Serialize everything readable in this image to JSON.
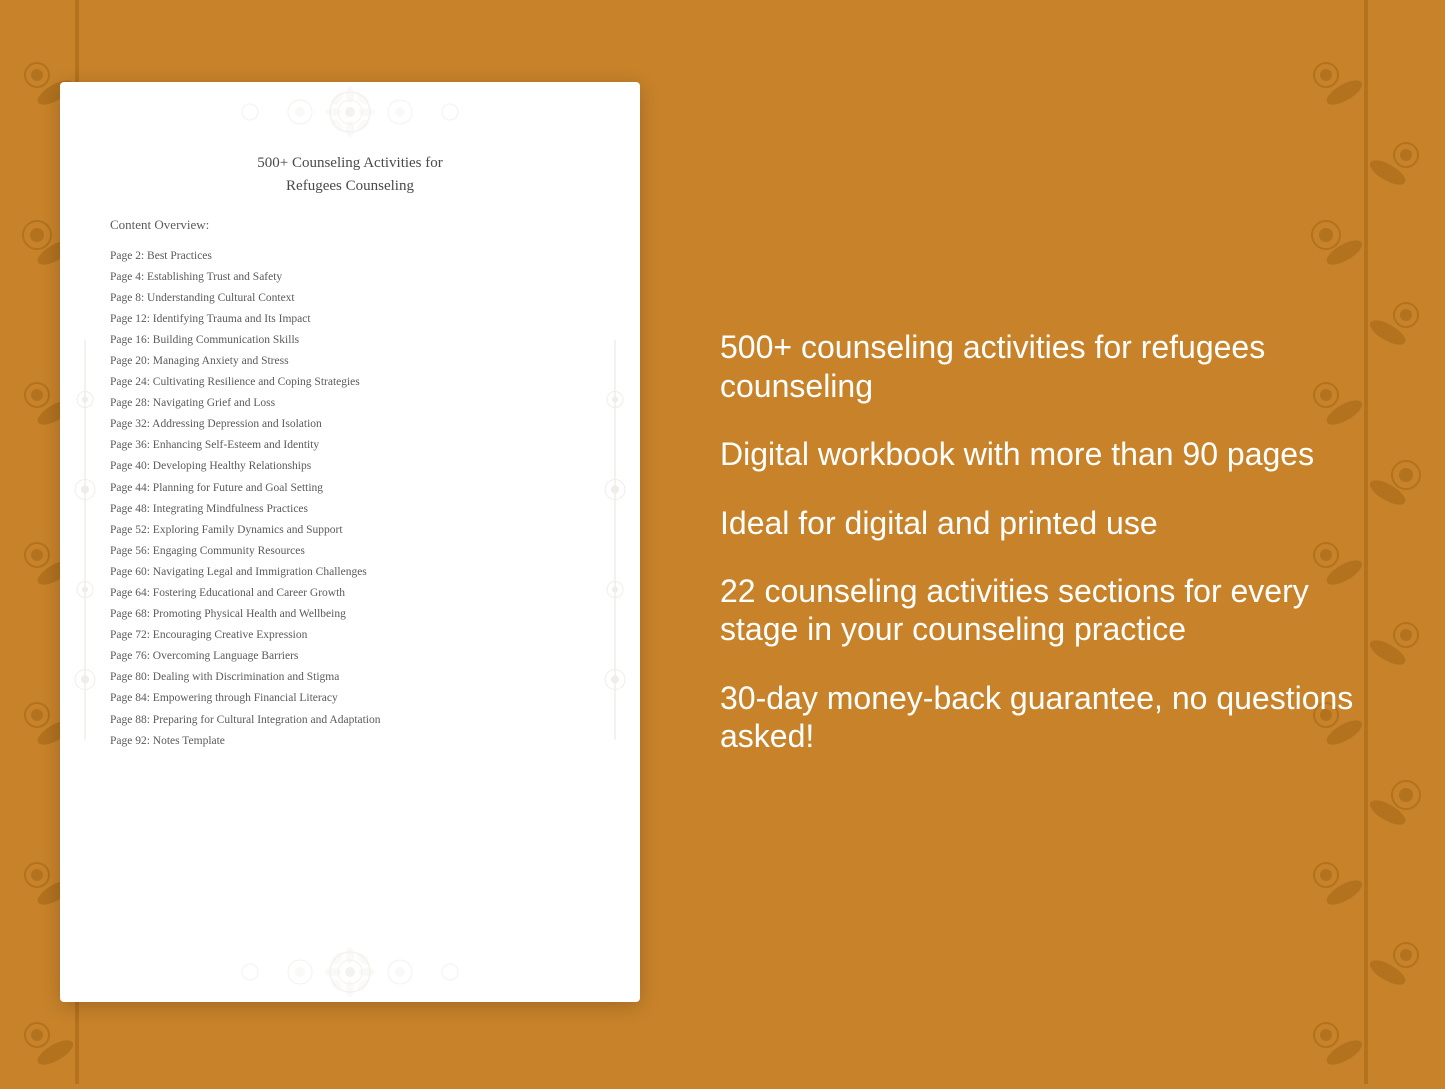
{
  "document": {
    "title_line1": "500+ Counseling Activities for",
    "title_line2": "Refugees Counseling",
    "content_overview_label": "Content Overview:",
    "toc": [
      {
        "page": "Page  2:",
        "title": "Best Practices"
      },
      {
        "page": "Page  4:",
        "title": "Establishing Trust and Safety"
      },
      {
        "page": "Page  8:",
        "title": "Understanding Cultural Context"
      },
      {
        "page": "Page 12:",
        "title": "Identifying Trauma and Its Impact"
      },
      {
        "page": "Page 16:",
        "title": "Building Communication Skills"
      },
      {
        "page": "Page 20:",
        "title": "Managing Anxiety and Stress"
      },
      {
        "page": "Page 24:",
        "title": "Cultivating Resilience and Coping Strategies"
      },
      {
        "page": "Page 28:",
        "title": "Navigating Grief and Loss"
      },
      {
        "page": "Page 32:",
        "title": "Addressing Depression and Isolation"
      },
      {
        "page": "Page 36:",
        "title": "Enhancing Self-Esteem and Identity"
      },
      {
        "page": "Page 40:",
        "title": "Developing Healthy Relationships"
      },
      {
        "page": "Page 44:",
        "title": "Planning for Future and Goal Setting"
      },
      {
        "page": "Page 48:",
        "title": "Integrating Mindfulness Practices"
      },
      {
        "page": "Page 52:",
        "title": "Exploring Family Dynamics and Support"
      },
      {
        "page": "Page 56:",
        "title": "Engaging Community Resources"
      },
      {
        "page": "Page 60:",
        "title": "Navigating Legal and Immigration Challenges"
      },
      {
        "page": "Page 64:",
        "title": "Fostering Educational and Career Growth"
      },
      {
        "page": "Page 68:",
        "title": "Promoting Physical Health and Wellbeing"
      },
      {
        "page": "Page 72:",
        "title": "Encouraging Creative Expression"
      },
      {
        "page": "Page 76:",
        "title": "Overcoming Language Barriers"
      },
      {
        "page": "Page 80:",
        "title": "Dealing with Discrimination and Stigma"
      },
      {
        "page": "Page 84:",
        "title": "Empowering through Financial Literacy"
      },
      {
        "page": "Page 88:",
        "title": "Preparing for Cultural Integration and Adaptation"
      },
      {
        "page": "Page 92:",
        "title": "Notes Template"
      }
    ]
  },
  "features": [
    "500+ counseling activities for refugees counseling",
    "Digital workbook with more than 90 pages",
    "Ideal for digital and printed use",
    "22 counseling activities sections for every stage in your counseling practice",
    "30-day money-back guarantee, no questions asked!"
  ]
}
